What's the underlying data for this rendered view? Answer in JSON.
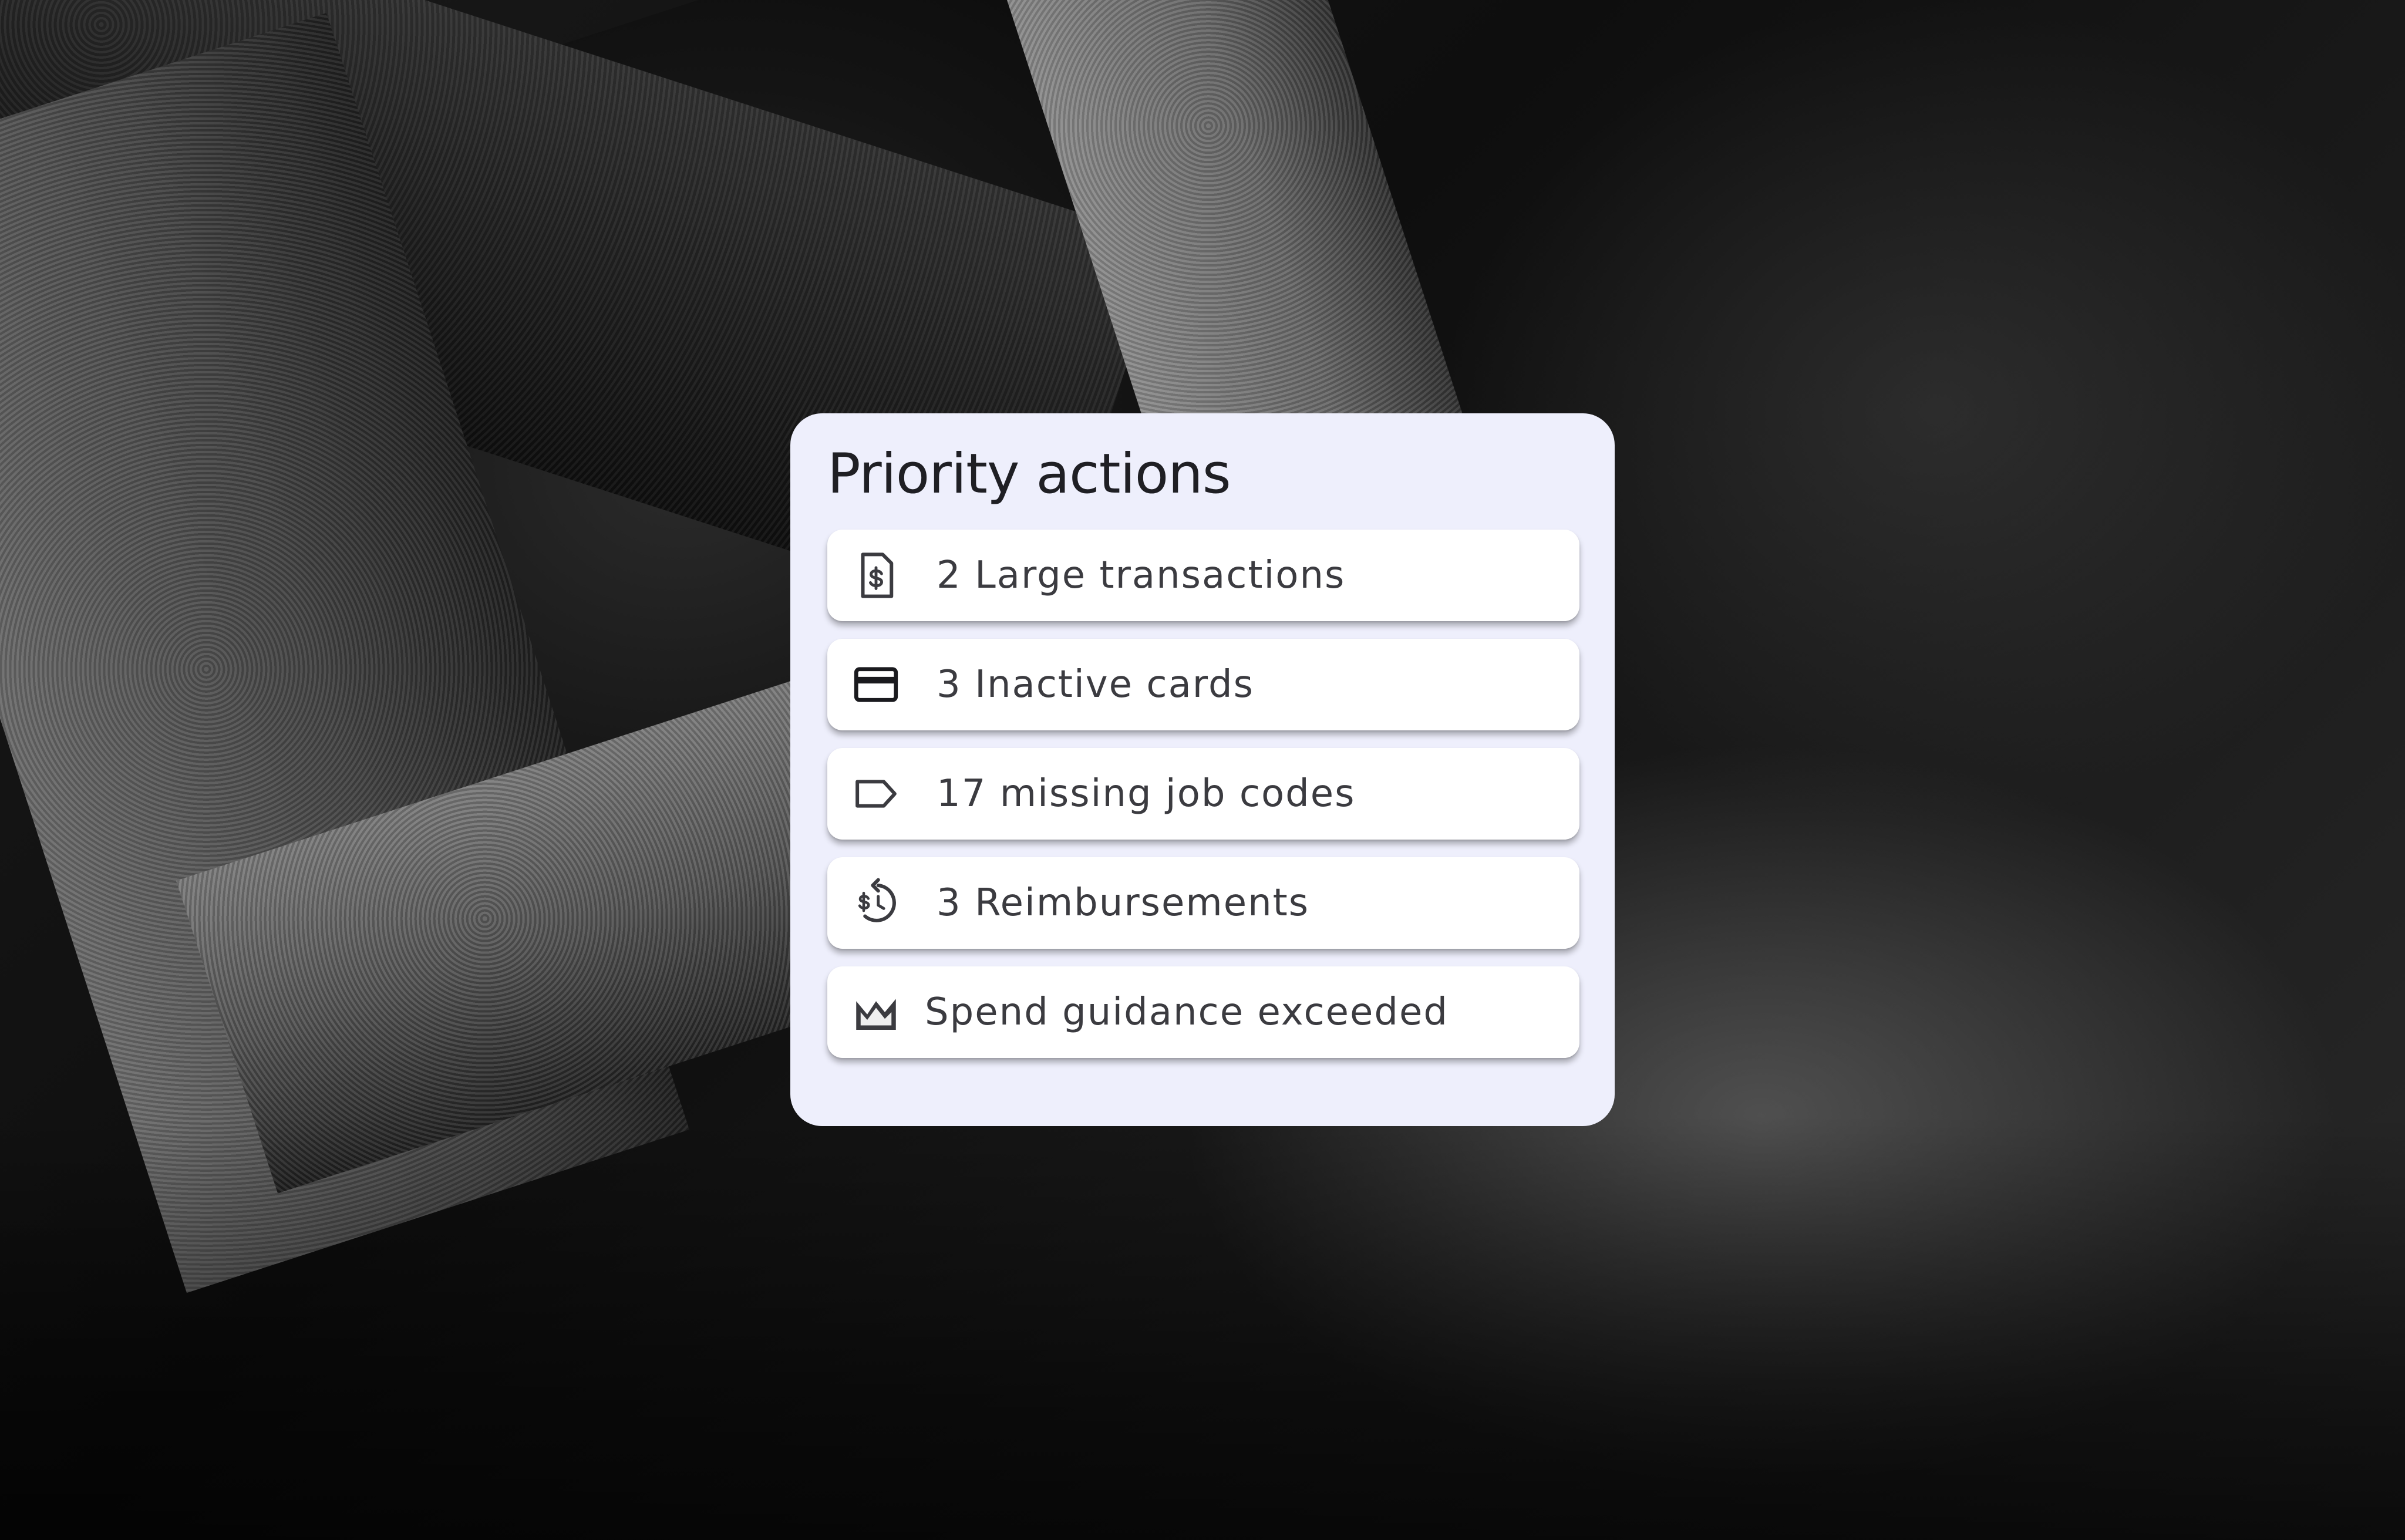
{
  "card": {
    "title": "Priority actions",
    "background_color": "#eeeffc",
    "items": [
      {
        "icon": "invoice-dollar-icon",
        "label": "2 Large transactions"
      },
      {
        "icon": "credit-card-icon",
        "label": "3 Inactive cards"
      },
      {
        "icon": "label-tag-icon",
        "label": "17 missing job codes"
      },
      {
        "icon": "reimbursement-icon",
        "label": "3 Reimbursements"
      },
      {
        "icon": "spend-chart-icon",
        "label": "Spend guidance exceeded"
      }
    ]
  }
}
